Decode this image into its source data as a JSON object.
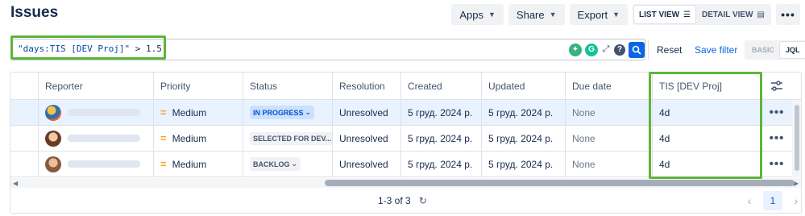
{
  "page": {
    "title": "Issues"
  },
  "toolbar": {
    "apps_label": "Apps",
    "share_label": "Share",
    "export_label": "Export",
    "list_view_label": "LIST VIEW",
    "detail_view_label": "DETAIL VIEW",
    "more_label": "•••"
  },
  "search": {
    "jql_field": "\"days:TIS [DEV Proj]\"",
    "jql_rest": "> 1.5",
    "reset_label": "Reset",
    "save_filter_label": "Save filter",
    "mode_basic": "BASIC",
    "mode_jql": "JQL",
    "grammarly_letter": "G",
    "help_glyph": "?"
  },
  "table": {
    "columns": [
      "",
      "Reporter",
      "Priority",
      "Status",
      "Resolution",
      "Created",
      "Updated",
      "Due date",
      "TIS [DEV Proj]"
    ],
    "rows": [
      {
        "reporter": "",
        "priority": "Medium",
        "status": "IN PROGRESS",
        "resolution": "Unresolved",
        "created": "5 груд. 2024 р.",
        "updated": "5 груд. 2024 р.",
        "due": "None",
        "tis": "4d",
        "selected": true
      },
      {
        "reporter": "",
        "priority": "Medium",
        "status": "SELECTED FOR DEV...",
        "resolution": "Unresolved",
        "created": "5 груд. 2024 р.",
        "updated": "5 груд. 2024 р.",
        "due": "None",
        "tis": "4d",
        "selected": false
      },
      {
        "reporter": "",
        "priority": "Medium",
        "status": "BACKLOG",
        "resolution": "Unresolved",
        "created": "5 груд. 2024 р.",
        "updated": "5 груд. 2024 р.",
        "due": "None",
        "tis": "4d",
        "selected": false
      }
    ],
    "row_actions_label": "•••"
  },
  "footer": {
    "count": "1-3 of 3",
    "current_page": "1"
  },
  "colors": {
    "highlight": "#5fb53a",
    "accent": "#0c66e4",
    "priority_medium": "#ff991f"
  },
  "icons": [
    "search-icon",
    "help-icon",
    "expand-icon",
    "grammarly-icon",
    "lightbulb-icon",
    "settings-icon",
    "refresh-icon",
    "chevron-down-icon",
    "list-view-icon",
    "detail-view-icon"
  ]
}
